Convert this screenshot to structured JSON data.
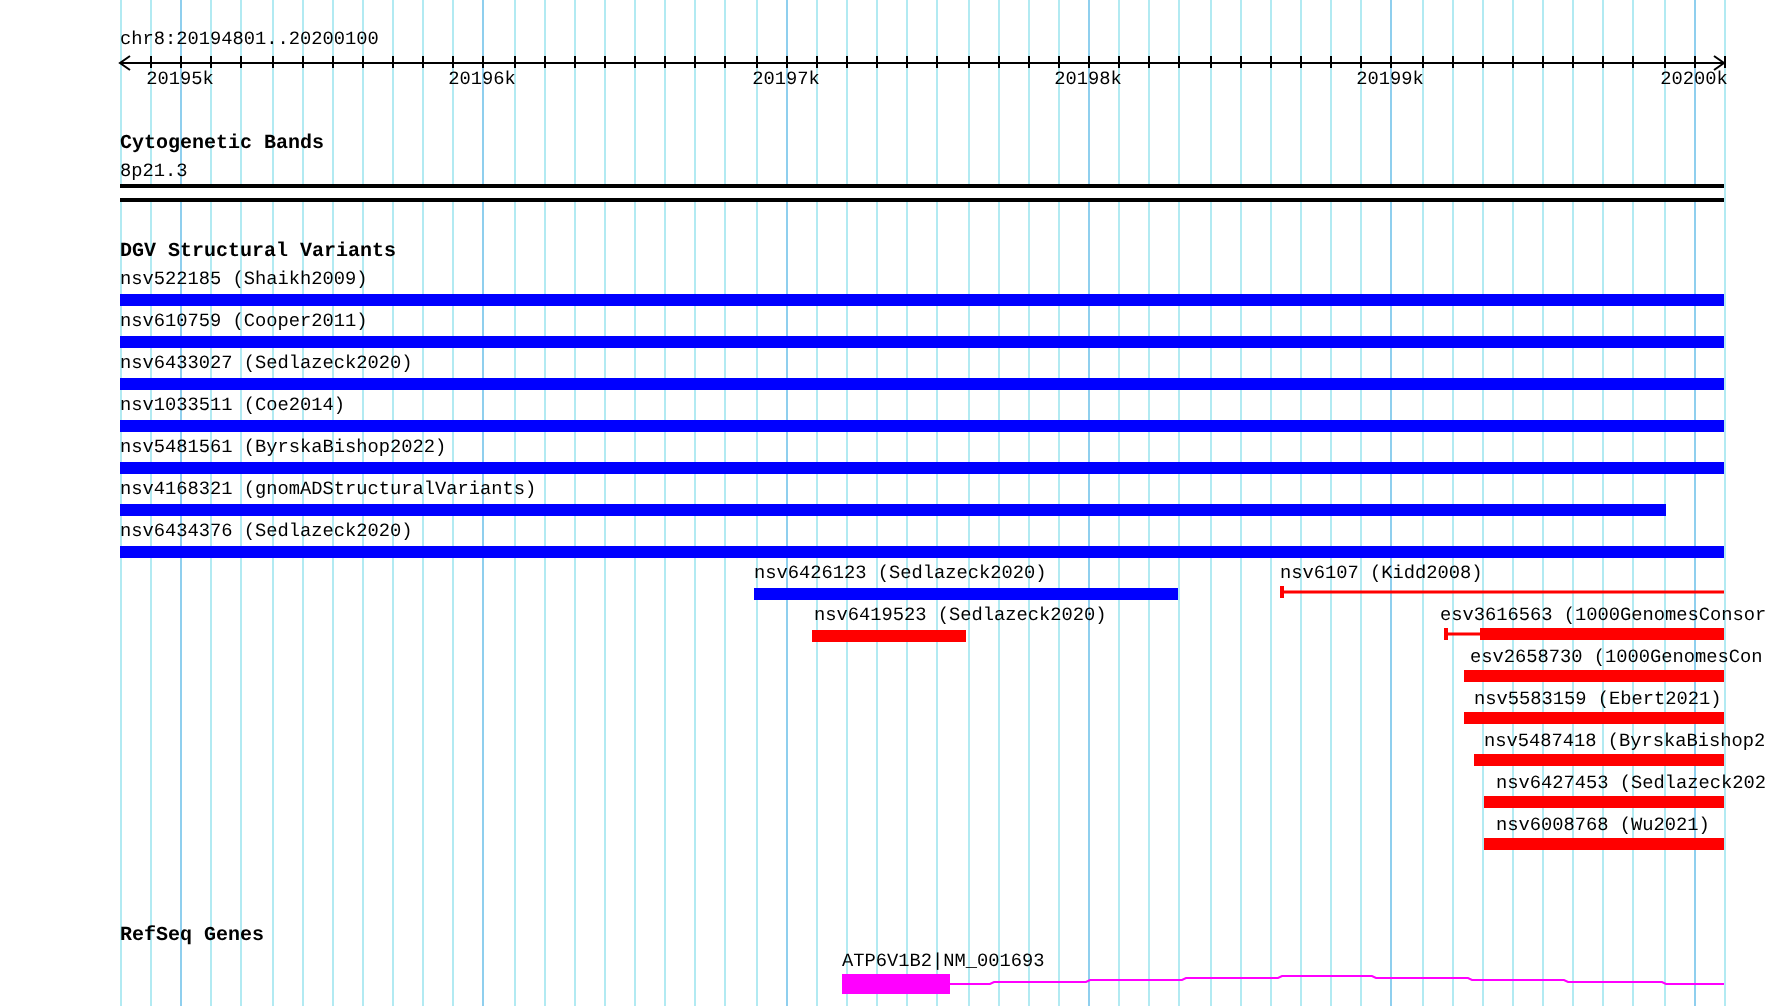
{
  "ruler": {
    "location": "chr8:20194801..20200100",
    "ticks": [
      "20195k",
      "20196k",
      "20197k",
      "20198k",
      "20199k",
      "20200k"
    ]
  },
  "tracks": [
    {
      "kind": "bands",
      "title": "Cytogenetic Bands",
      "items": [
        {
          "label": "8p21.3"
        }
      ]
    },
    {
      "kind": "variants",
      "title": "DGV Structural Variants",
      "items": [
        {
          "label": "nsv522185 (Shaikh2009)",
          "color": "#0000ff",
          "kind": "bar"
        },
        {
          "label": "nsv610759 (Cooper2011)",
          "color": "#0000ff",
          "kind": "bar"
        },
        {
          "label": "nsv6433027 (Sedlazeck2020)",
          "color": "#0000ff",
          "kind": "bar"
        },
        {
          "label": "nsv1033511 (Coe2014)",
          "color": "#0000ff",
          "kind": "bar"
        },
        {
          "label": "nsv5481561 (ByrskaBishop2022)",
          "color": "#0000ff",
          "kind": "bar"
        },
        {
          "label": "nsv4168321 (gnomADStructuralVariants)",
          "color": "#0000ff",
          "kind": "bar"
        },
        {
          "label": "nsv6434376 (Sedlazeck2020)",
          "color": "#0000ff",
          "kind": "bar"
        },
        {
          "label": "nsv6426123 (Sedlazeck2020)",
          "color": "#0000ff",
          "kind": "bar"
        },
        {
          "label": "nsv6107 (Kidd2008)",
          "color": "#ff0000",
          "kind": "line"
        },
        {
          "label": "nsv6419523 (Sedlazeck2020)",
          "color": "#ff0000",
          "kind": "bar"
        },
        {
          "label": "esv3616563 (1000GenomesConsor",
          "color": "#ff0000",
          "kind": "stub"
        },
        {
          "label": "esv2658730 (1000GenomesCon",
          "color": "#ff0000",
          "kind": "bar"
        },
        {
          "label": "nsv5583159 (Ebert2021)",
          "color": "#ff0000",
          "kind": "bar"
        },
        {
          "label": "nsv5487418 (ByrskaBishop2",
          "color": "#ff0000",
          "kind": "bar"
        },
        {
          "label": "nsv6427453 (Sedlazeck202",
          "color": "#ff0000",
          "kind": "bar"
        },
        {
          "label": "nsv6008768 (Wu2021)",
          "color": "#ff0000",
          "kind": "bar"
        }
      ]
    },
    {
      "kind": "genes",
      "title": "RefSeq Genes",
      "items": [
        {
          "label": "ATP6V1B2|NM_001693"
        }
      ]
    }
  ]
}
